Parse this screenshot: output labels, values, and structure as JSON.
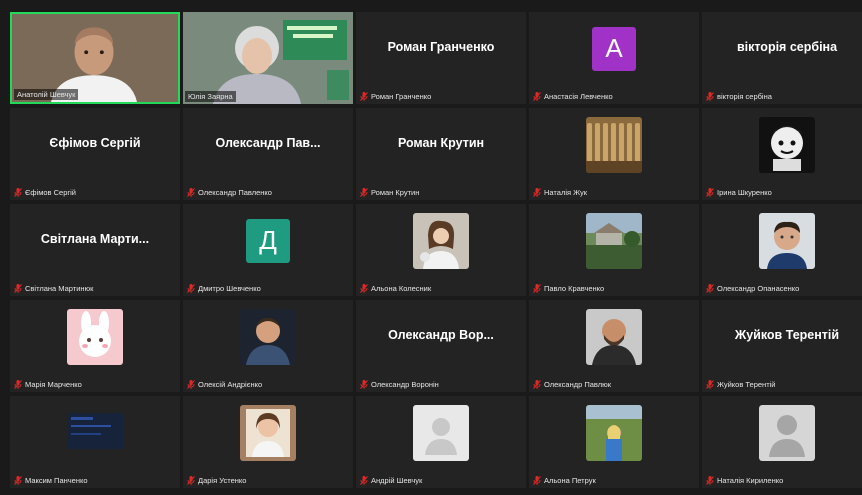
{
  "colors": {
    "background": "#1a1a1a",
    "tile": "#232323",
    "active_speaker_border": "#23d959",
    "mute_icon": "#e02828"
  },
  "tiles": [
    {
      "display_name": "",
      "footer": "Анатолій Шевчук",
      "kind": "video",
      "active": true
    },
    {
      "display_name": "",
      "footer": "Юлія Заярна",
      "kind": "video"
    },
    {
      "display_name": "Роман Гранченко",
      "footer": "Роман Гранченко",
      "kind": "name",
      "muted": true
    },
    {
      "display_name": "",
      "footer": "Анастасія Левченко",
      "kind": "letter",
      "letter": "A",
      "color": "#a032c8",
      "muted": true
    },
    {
      "display_name": "вікторія сербіна",
      "footer": "вікторія сербіна",
      "kind": "name",
      "muted": true
    },
    {
      "display_name": "Єфімов Сергій",
      "footer": "Єфімов Сергій",
      "kind": "name",
      "muted": true
    },
    {
      "display_name": "Олександр Пав...",
      "footer": "Олександр Павленко",
      "kind": "name",
      "muted": true
    },
    {
      "display_name": "Роман Крутин",
      "footer": "Роман Крутин",
      "kind": "name",
      "muted": true
    },
    {
      "display_name": "",
      "footer": "Наталія Жук",
      "kind": "photo",
      "photo": "wheat",
      "muted": true
    },
    {
      "display_name": "",
      "footer": "Ірина Шкуренко",
      "kind": "photo",
      "photo": "drawing",
      "muted": true
    },
    {
      "display_name": "Світлана Марти...",
      "footer": "Світлана Мартинюк",
      "kind": "name",
      "muted": true
    },
    {
      "display_name": "",
      "footer": "Дмитро Шевченко",
      "kind": "letter",
      "letter": "Д",
      "color": "#1e9b80",
      "muted": true
    },
    {
      "display_name": "",
      "footer": "Альона Колесник",
      "kind": "photo",
      "photo": "woman",
      "muted": true
    },
    {
      "display_name": "",
      "footer": "Павло Кравченко",
      "kind": "photo",
      "photo": "landscape",
      "muted": true
    },
    {
      "display_name": "",
      "footer": "Олександр Опанасенко",
      "kind": "photo",
      "photo": "man",
      "muted": true
    },
    {
      "display_name": "",
      "footer": "Марія Марченко",
      "kind": "photo",
      "photo": "bunny",
      "muted": true
    },
    {
      "display_name": "",
      "footer": "Олексій Андрієнко",
      "kind": "photo",
      "photo": "man2",
      "muted": true
    },
    {
      "display_name": "Олександр Вор...",
      "footer": "Олександр Воронін",
      "kind": "name",
      "muted": true
    },
    {
      "display_name": "",
      "footer": "Олександр Павлюк",
      "kind": "photo",
      "photo": "man3",
      "muted": true
    },
    {
      "display_name": "Жуйков Терентій",
      "footer": "Жуйков Терентій",
      "kind": "name",
      "muted": true
    },
    {
      "display_name": "",
      "footer": "Максим Панченко",
      "kind": "photo",
      "photo": "blue",
      "muted": true
    },
    {
      "display_name": "",
      "footer": "Дарія Устенко",
      "kind": "photo",
      "photo": "woman2",
      "muted": true
    },
    {
      "display_name": "",
      "footer": "Андрій Шевчук",
      "kind": "photo",
      "photo": "blank",
      "muted": true
    },
    {
      "display_name": "",
      "footer": "Альона Петрук",
      "kind": "photo",
      "photo": "field",
      "muted": true
    },
    {
      "display_name": "",
      "footer": "Наталія Кириленко",
      "kind": "photo",
      "photo": "default",
      "muted": true
    }
  ]
}
